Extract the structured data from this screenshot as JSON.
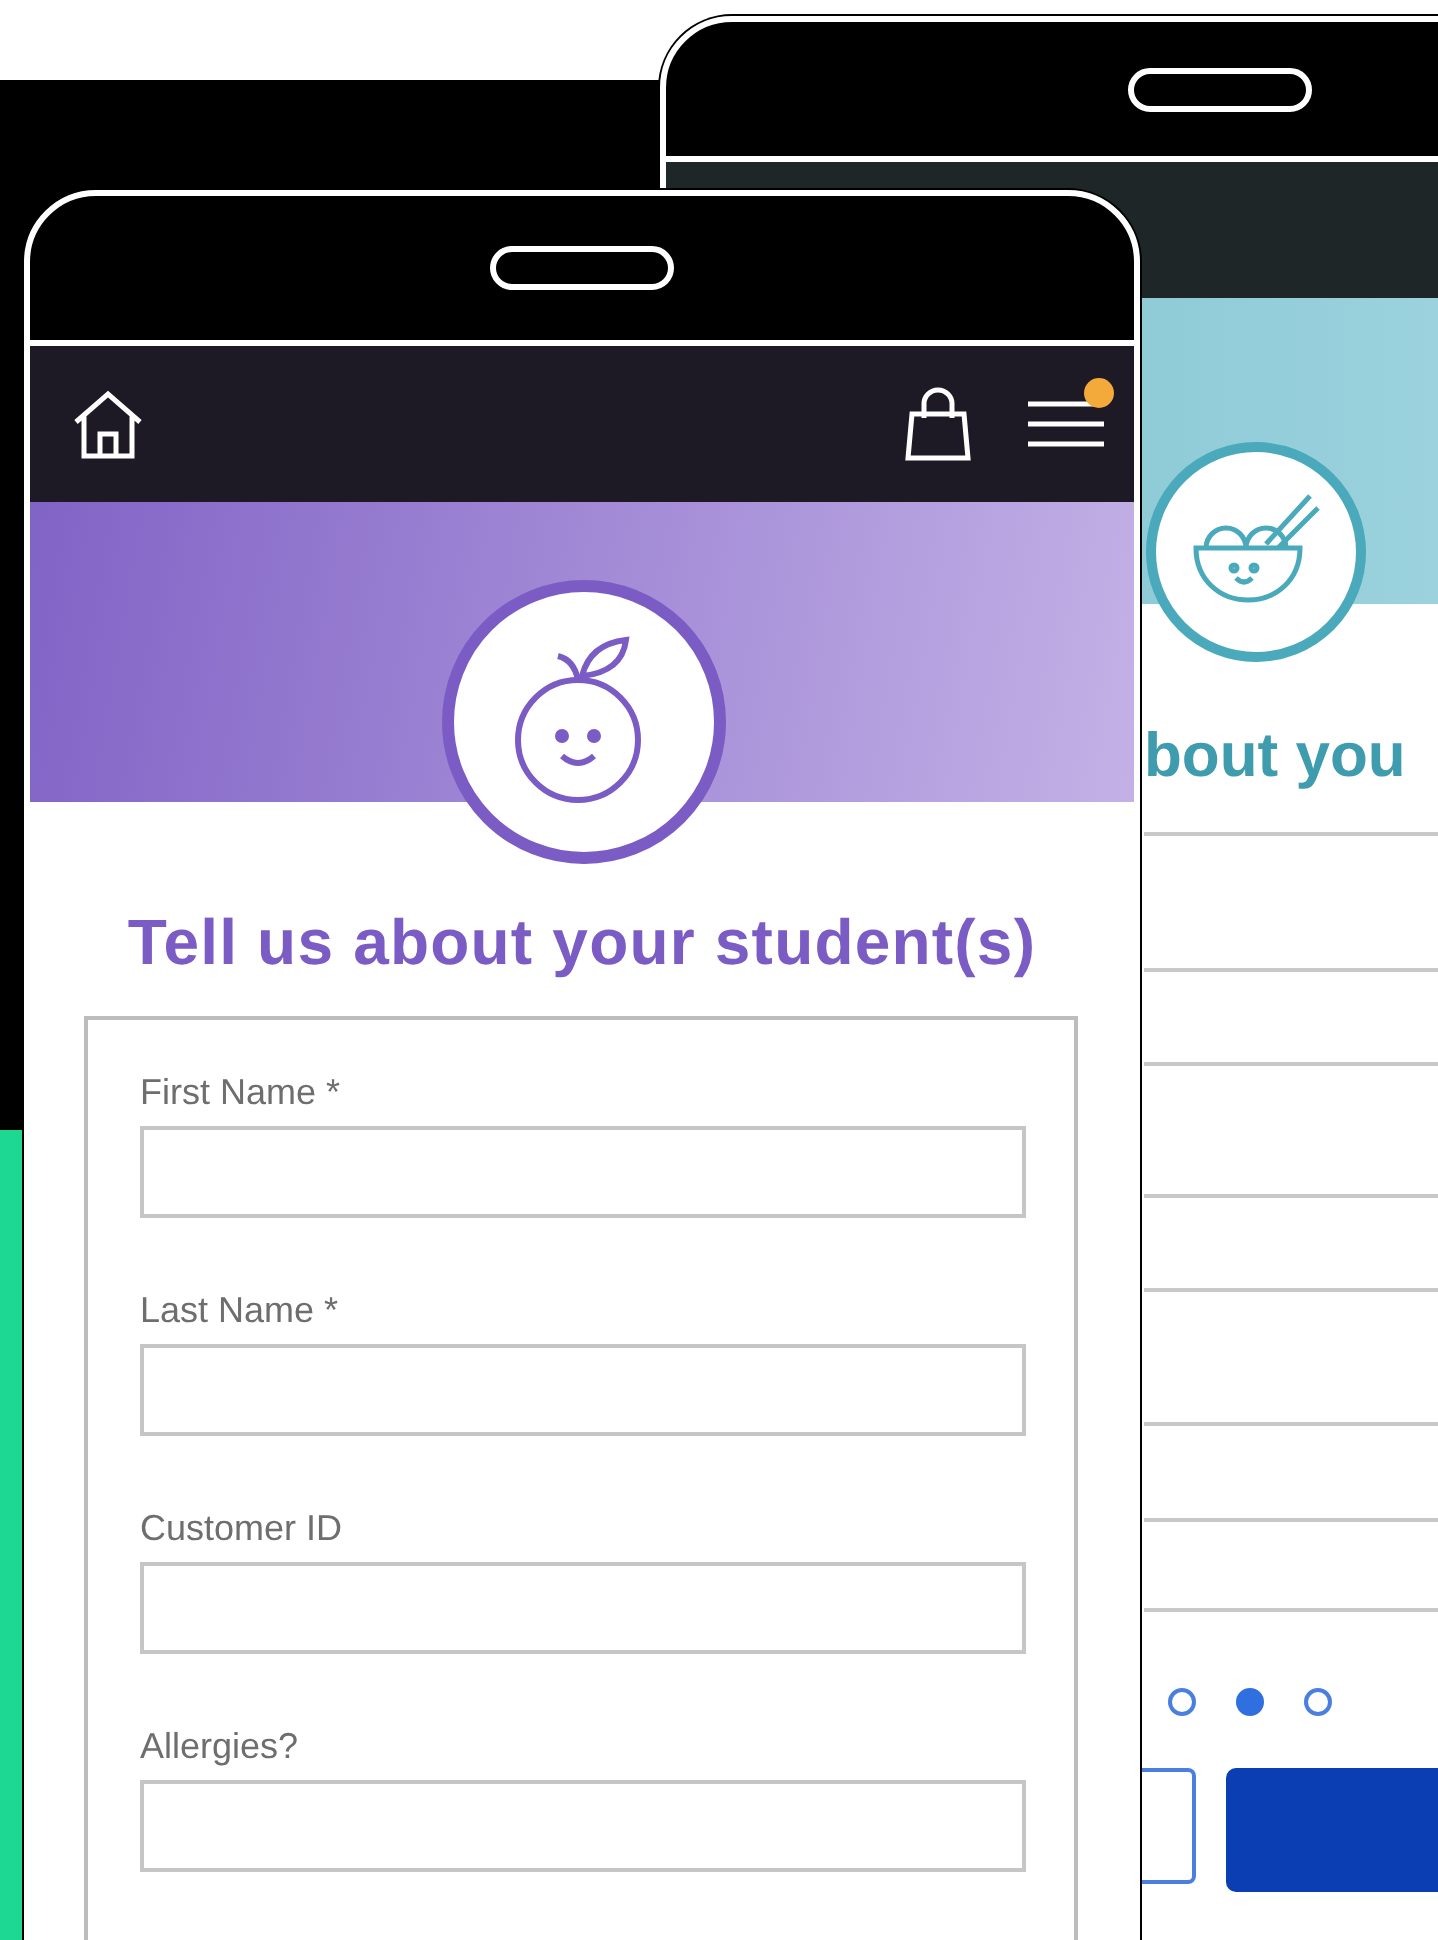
{
  "back_phone": {
    "title": "bout you",
    "page_dots": [
      {
        "selected": false
      },
      {
        "selected": true
      },
      {
        "selected": false
      }
    ]
  },
  "front_phone": {
    "menu": {
      "badge": true
    },
    "title": "Tell us about your student(s)",
    "fields": [
      {
        "label": "First Name *"
      },
      {
        "label": "Last Name *"
      },
      {
        "label": "Customer ID"
      },
      {
        "label": "Allergies?"
      }
    ]
  }
}
